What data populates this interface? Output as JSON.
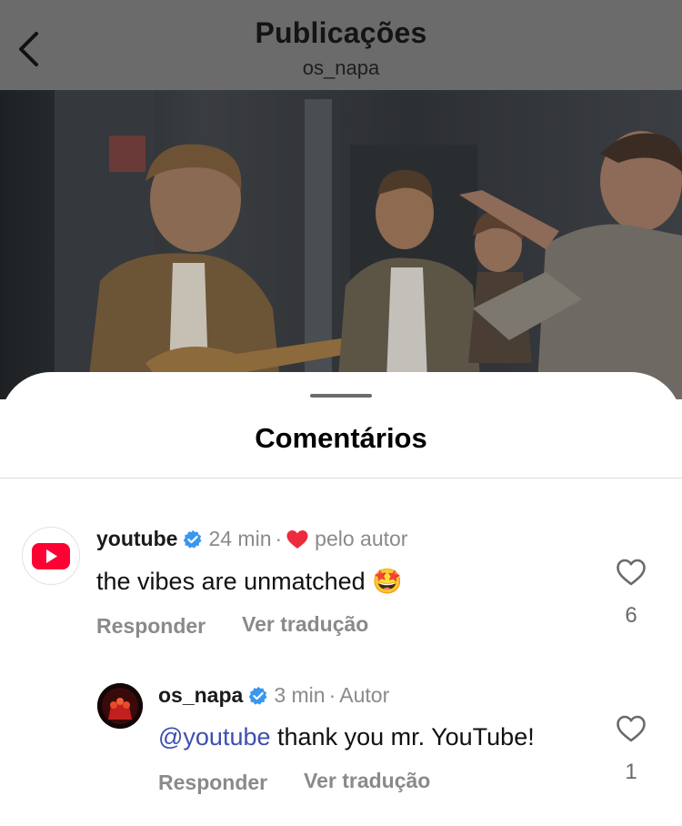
{
  "header": {
    "title": "Publicações",
    "subtitle": "os_napa",
    "back_icon": "chevron-left-icon"
  },
  "sheet": {
    "title": "Comentários"
  },
  "comments": [
    {
      "username": "youtube",
      "verified": true,
      "time": "24 min",
      "liked_by_author_label": "pelo autor",
      "text": "the vibes are unmatched",
      "emoji": "🤩",
      "reply_label": "Responder",
      "translate_label": "Ver tradução",
      "likes": "6",
      "avatar_icon": "youtube-logo-icon"
    },
    {
      "username": "os_napa",
      "verified": true,
      "time": "3 min",
      "author_label": "Autor",
      "mention": "@youtube",
      "text": "thank you mr. YouTube!",
      "reply_label": "Responder",
      "translate_label": "Ver tradução",
      "likes": "1",
      "avatar_icon": "profile-photo"
    }
  ],
  "colors": {
    "header_bg": "#6b6b6b",
    "verified_blue": "#3897f0",
    "heart_red": "#ed2b3f",
    "youtube_red": "#ff0000",
    "mention_blue": "#3c4fb0"
  }
}
